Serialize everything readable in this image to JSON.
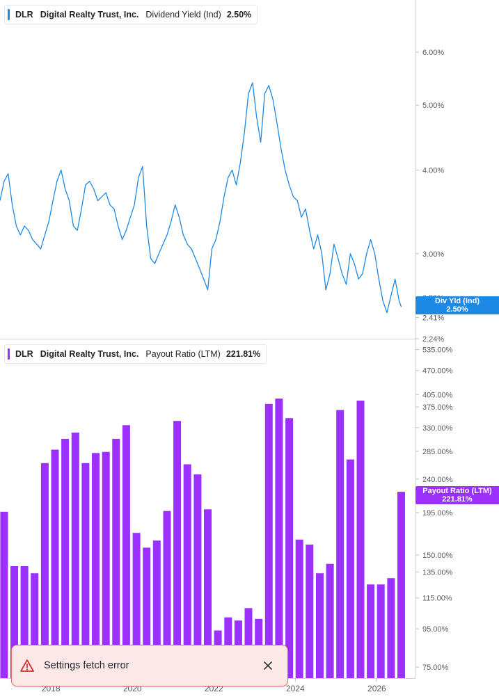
{
  "colors": {
    "yield_line": "#1e88e5",
    "payout_bar": "#9b30ff",
    "toast_bg": "#fde8e8",
    "toast_border": "#e06b6b",
    "axis_text": "#555b63"
  },
  "legend_top": {
    "ticker": "DLR",
    "company": "Digital Realty Trust, Inc.",
    "metric": "Dividend Yield (Ind)",
    "value": "2.50%"
  },
  "legend_bottom": {
    "ticker": "DLR",
    "company": "Digital Realty Trust, Inc.",
    "metric": "Payout Ratio (LTM)",
    "value": "221.81%"
  },
  "tag_top": {
    "label": "Div Yld (Ind)",
    "value": "2.50%"
  },
  "tag_bottom": {
    "label": "Payout Ratio (LTM)",
    "value": "221.81%"
  },
  "toast": {
    "message": "Settings fetch error",
    "warning_icon": "warning-triangle-icon",
    "close_icon": "close-icon"
  },
  "chart_data": [
    {
      "type": "line",
      "scale": "log",
      "ylim": [
        2.24,
        6.6
      ],
      "yticks": [
        2.24,
        2.41,
        2.58,
        3.0,
        4.0,
        5.0,
        6.0
      ],
      "ytick_labels": [
        "2.24%",
        "2.41%",
        "2.58%",
        "3.00%",
        "4.00%",
        "5.00%",
        "6.00%"
      ],
      "xlim": [
        2016.75,
        2026.95
      ],
      "x": [
        2016.75,
        2016.85,
        2016.95,
        2017.05,
        2017.15,
        2017.25,
        2017.35,
        2017.45,
        2017.55,
        2017.65,
        2017.75,
        2017.85,
        2017.95,
        2018.05,
        2018.15,
        2018.25,
        2018.35,
        2018.45,
        2018.55,
        2018.65,
        2018.75,
        2018.85,
        2018.95,
        2019.05,
        2019.15,
        2019.25,
        2019.35,
        2019.45,
        2019.55,
        2019.65,
        2019.75,
        2019.85,
        2019.95,
        2020.05,
        2020.15,
        2020.25,
        2020.35,
        2020.45,
        2020.55,
        2020.65,
        2020.75,
        2020.85,
        2020.95,
        2021.05,
        2021.15,
        2021.25,
        2021.35,
        2021.45,
        2021.55,
        2021.65,
        2021.75,
        2021.85,
        2021.95,
        2022.05,
        2022.15,
        2022.25,
        2022.35,
        2022.45,
        2022.55,
        2022.65,
        2022.75,
        2022.85,
        2022.95,
        2023.05,
        2023.15,
        2023.25,
        2023.35,
        2023.45,
        2023.55,
        2023.65,
        2023.75,
        2023.85,
        2023.95,
        2024.05,
        2024.15,
        2024.25,
        2024.35,
        2024.45,
        2024.55,
        2024.65,
        2024.75,
        2024.85,
        2024.95,
        2025.05,
        2025.15,
        2025.25,
        2025.35,
        2025.45,
        2025.55,
        2025.65,
        2025.75,
        2025.85,
        2025.95,
        2026.05,
        2026.15,
        2026.25,
        2026.35,
        2026.45,
        2026.55,
        2026.6
      ],
      "y": [
        3.6,
        3.85,
        3.95,
        3.55,
        3.3,
        3.2,
        3.3,
        3.25,
        3.15,
        3.1,
        3.05,
        3.2,
        3.35,
        3.6,
        3.85,
        4.0,
        3.75,
        3.6,
        3.3,
        3.25,
        3.5,
        3.8,
        3.85,
        3.75,
        3.6,
        3.65,
        3.7,
        3.55,
        3.5,
        3.3,
        3.15,
        3.25,
        3.4,
        3.55,
        3.9,
        4.05,
        3.3,
        2.95,
        2.9,
        3.0,
        3.1,
        3.2,
        3.35,
        3.55,
        3.4,
        3.2,
        3.1,
        3.05,
        2.95,
        2.85,
        2.75,
        2.65,
        3.05,
        3.15,
        3.35,
        3.65,
        3.9,
        4.0,
        3.8,
        4.1,
        4.55,
        5.2,
        5.4,
        4.8,
        4.4,
        5.2,
        5.35,
        5.1,
        4.7,
        4.3,
        4.0,
        3.8,
        3.65,
        3.6,
        3.4,
        3.5,
        3.25,
        3.05,
        3.2,
        3.0,
        2.65,
        2.8,
        3.1,
        2.95,
        2.8,
        2.7,
        3.0,
        2.9,
        2.75,
        2.8,
        3.0,
        3.15,
        3.0,
        2.75,
        2.55,
        2.45,
        2.6,
        2.75,
        2.55,
        2.5
      ]
    },
    {
      "type": "bar",
      "scale": "log",
      "ylim": [
        70,
        560
      ],
      "yticks": [
        75,
        95,
        115,
        135,
        150,
        195,
        240,
        285,
        330,
        375,
        405,
        470,
        535
      ],
      "ytick_labels": [
        "75.00%",
        "95.00%",
        "115.00%",
        "135.00%",
        "150.00%",
        "195.00%",
        "240.00%",
        "285.00%",
        "330.00%",
        "375.00%",
        "405.00%",
        "470.00%",
        "535.00%"
      ],
      "xlim": [
        2016.75,
        2026.95
      ],
      "x": [
        2016.85,
        2017.1,
        2017.35,
        2017.6,
        2017.85,
        2018.1,
        2018.35,
        2018.6,
        2018.85,
        2019.1,
        2019.35,
        2019.6,
        2019.85,
        2020.1,
        2020.35,
        2020.6,
        2020.85,
        2021.1,
        2021.35,
        2021.6,
        2021.85,
        2022.1,
        2022.35,
        2022.6,
        2022.85,
        2023.1,
        2023.35,
        2023.6,
        2023.85,
        2024.1,
        2024.35,
        2024.6,
        2024.85,
        2025.1,
        2025.35,
        2025.6,
        2025.85,
        2026.1,
        2026.35,
        2026.6
      ],
      "values": [
        196,
        140,
        140,
        134,
        265,
        288,
        308,
        320,
        265,
        282,
        284,
        308,
        335,
        172,
        157,
        164,
        197,
        344,
        263,
        247,
        199,
        94,
        102,
        100,
        108,
        101,
        382,
        395,
        350,
        165,
        160,
        134,
        142,
        368,
        271,
        390,
        125,
        125,
        130,
        221.81
      ]
    }
  ],
  "x_axis": {
    "tick_years": [
      2018,
      2020,
      2022,
      2024,
      2026
    ],
    "tick_labels": [
      "2018",
      "2020",
      "2022",
      "2024",
      "2026"
    ]
  }
}
